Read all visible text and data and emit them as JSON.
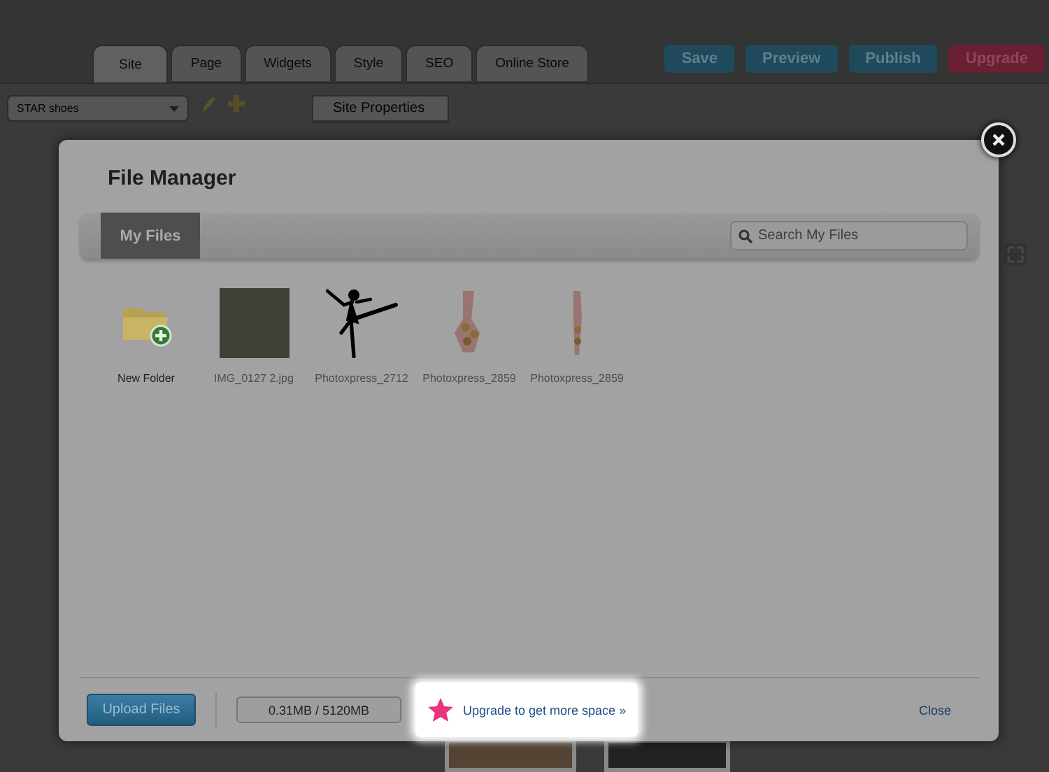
{
  "editor": {
    "tabs": [
      {
        "label": "Site",
        "selected": true
      },
      {
        "label": "Page",
        "selected": false
      },
      {
        "label": "Widgets",
        "selected": false
      },
      {
        "label": "Style",
        "selected": false
      },
      {
        "label": "SEO",
        "selected": false
      },
      {
        "label": "Online Store",
        "selected": false
      }
    ],
    "actions": [
      {
        "label": "Save",
        "kind": "primary"
      },
      {
        "label": "Preview",
        "kind": "primary"
      },
      {
        "label": "Publish",
        "kind": "primary"
      },
      {
        "label": "Upgrade",
        "kind": "upgrade"
      }
    ],
    "site_select": {
      "value": "STAR shoes"
    },
    "settings_menu": [
      "Site Properties"
    ]
  },
  "dialog": {
    "title": "File Manager",
    "tabs": [
      {
        "label": "My Files",
        "selected": true
      }
    ],
    "search": {
      "placeholder": "Search My Files"
    },
    "files": [
      {
        "name": "New Folder",
        "kind": "folder"
      },
      {
        "name": "IMG_0127 2.jpg",
        "kind": "photo"
      },
      {
        "name": "Photoxpress_2712",
        "kind": "silhouette"
      },
      {
        "name": "Photoxpress_2859",
        "kind": "flowers"
      },
      {
        "name": "Photoxpress_2859",
        "kind": "flowers-narrow"
      }
    ],
    "upload_button": "Upload Files",
    "storage": {
      "reading": "0.31MB / 5120MB"
    },
    "upgrade_link": "Upgrade to get more space »",
    "close_link": "Close"
  }
}
